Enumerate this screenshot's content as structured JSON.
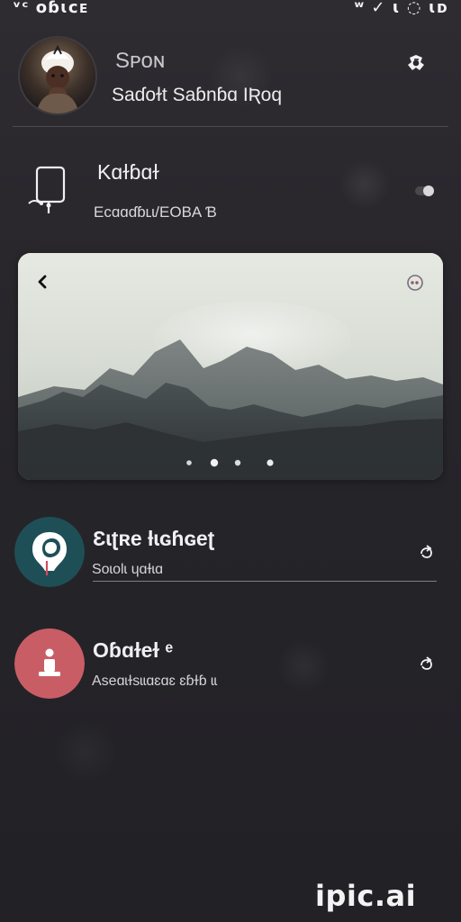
{
  "status_bar": {
    "left_text": "ᵛᶜ ᴏɓɩᴄᴇ",
    "right_text": "ʷ ✓ ɩ ◌ ɩᴅ"
  },
  "profile": {
    "name": "Sᴘᴏɴ",
    "subtitle": "Saɗoɫt Saɓnɓɑ IƦoq",
    "settings_icon": "settings-icon"
  },
  "device": {
    "title": "Kɑɫɓɑɫ",
    "subtitle": "Ecɑɑɗɓʟɩ/ΕΟΒΑ Ɓ",
    "toggle_icon": "toggle-icon"
  },
  "image_card": {
    "theme": "mountain-landscape",
    "active_page": 2,
    "page_count": 4,
    "back_icon": "chevron-left-icon",
    "more_icon": "more-icon"
  },
  "list_items": [
    {
      "title": "Ɛɩʈʀe ƚɩɢɦɢeʈ",
      "subtitle": "Soɩolɩ ɥɑɫɩɑ",
      "avatar_color": "#1f4f56",
      "icon": "app-icon"
    },
    {
      "title": "Oɓɑɫeɫ ᵉ",
      "subtitle": "Aseɑɩɫsɩɩɑɛɑɛ ɛɓɫɓ ɩɩ",
      "avatar_color": "#c95d66",
      "icon": "person-icon"
    }
  ],
  "watermark": "ipic.ai",
  "colors": {
    "background_top": "#2e2c31",
    "background_bottom": "#222126",
    "text_primary": "#f0f0f2",
    "text_secondary": "#d6d4d9",
    "accent_teal": "#1f4f56",
    "accent_pink": "#c95d66"
  }
}
